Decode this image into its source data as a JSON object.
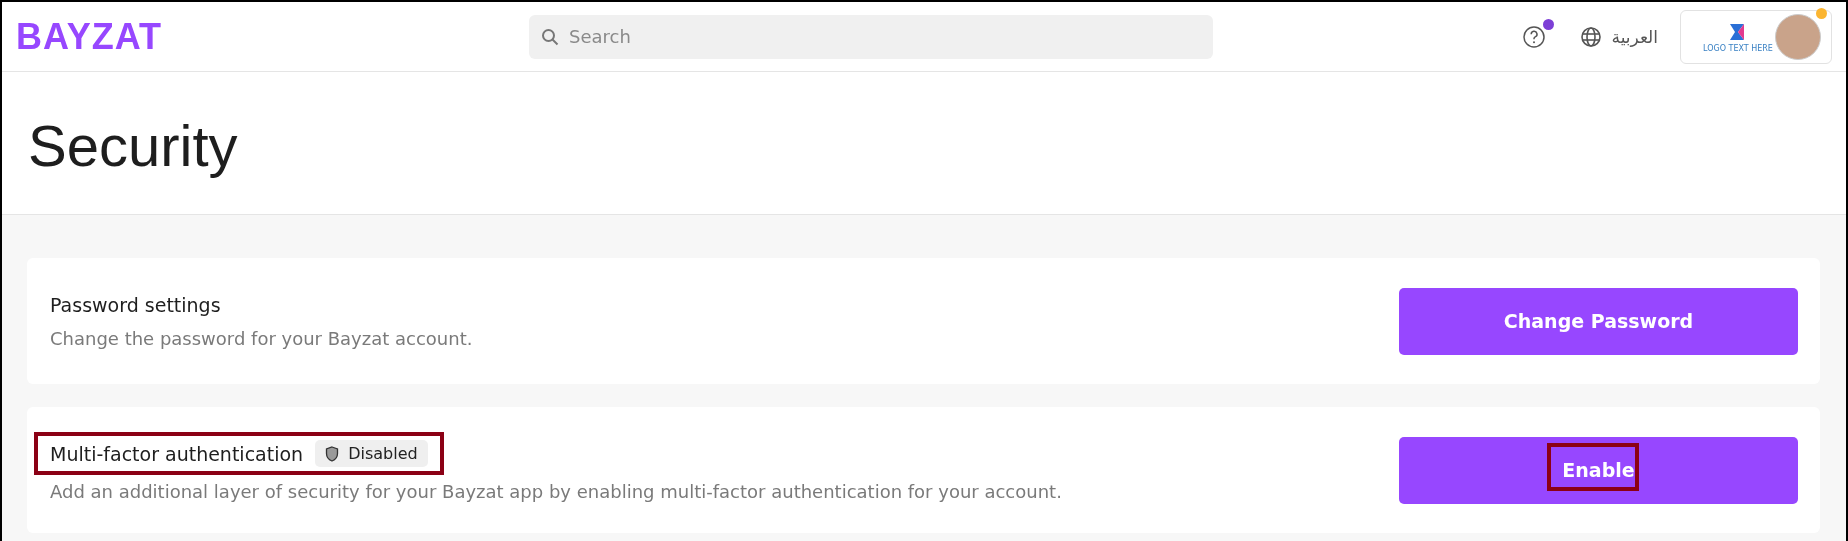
{
  "header": {
    "logo": "BAYZAT",
    "search": {
      "placeholder": "Search"
    },
    "help": {
      "has_notification": true
    },
    "language": "العربية",
    "company_logo_text": "LOGO TEXT HERE",
    "profile": {
      "has_notification": true
    }
  },
  "page": {
    "title": "Security"
  },
  "sections": [
    {
      "title": "Password settings",
      "description": "Change the password for your Bayzat account.",
      "button": {
        "label": "Change Password",
        "highlighted": false
      },
      "highlighted": false
    },
    {
      "title": "Multi-factor authentication",
      "badge": {
        "label": "Disabled",
        "enabled": false
      },
      "description": "Add an additional layer of security for your Bayzat app by enabling multi-factor authentication for your account.",
      "button": {
        "label": "Enable",
        "highlighted": true
      },
      "highlighted": true
    }
  ]
}
